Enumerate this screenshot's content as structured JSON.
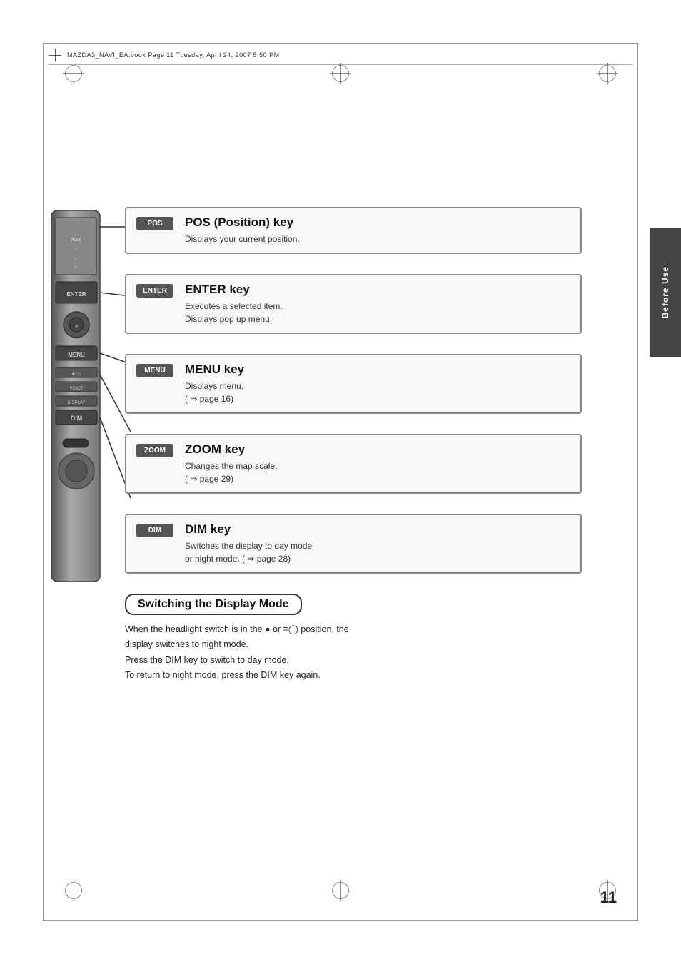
{
  "page": {
    "number": "11",
    "header_text": "MAZDA3_NAVI_EA.book   Page 11   Tuesday, April 24, 2007   5:50 PM"
  },
  "side_tab": {
    "label": "Before Use"
  },
  "keys": [
    {
      "id": "pos",
      "badge": "POS",
      "title": "POS (Position) key",
      "description": "Displays your current position."
    },
    {
      "id": "enter",
      "badge": "ENTER",
      "title": "ENTER key",
      "description": "Executes a selected item.\nDisplays pop up menu."
    },
    {
      "id": "menu",
      "badge": "MENU",
      "title": "MENU key",
      "description": "Displays menu.\n(⇒ page 16)"
    },
    {
      "id": "zoom",
      "badge": "ZOOM",
      "title": "ZOOM key",
      "description": "Changes the map scale.\n(⇒ page 29)"
    },
    {
      "id": "dim",
      "badge": "DIM",
      "title": "DIM key",
      "description": "Switches the display to day mode\nor night mode. ( ⇒ page 28)"
    }
  ],
  "display_mode": {
    "title": "Switching the Display Mode",
    "text": "When the headlight switch is in the ● or ≡○ position, the\ndisplay switches to night mode.\nPress the DIM key to switch to day mode.\nTo return to night mode, press the DIM key again."
  }
}
